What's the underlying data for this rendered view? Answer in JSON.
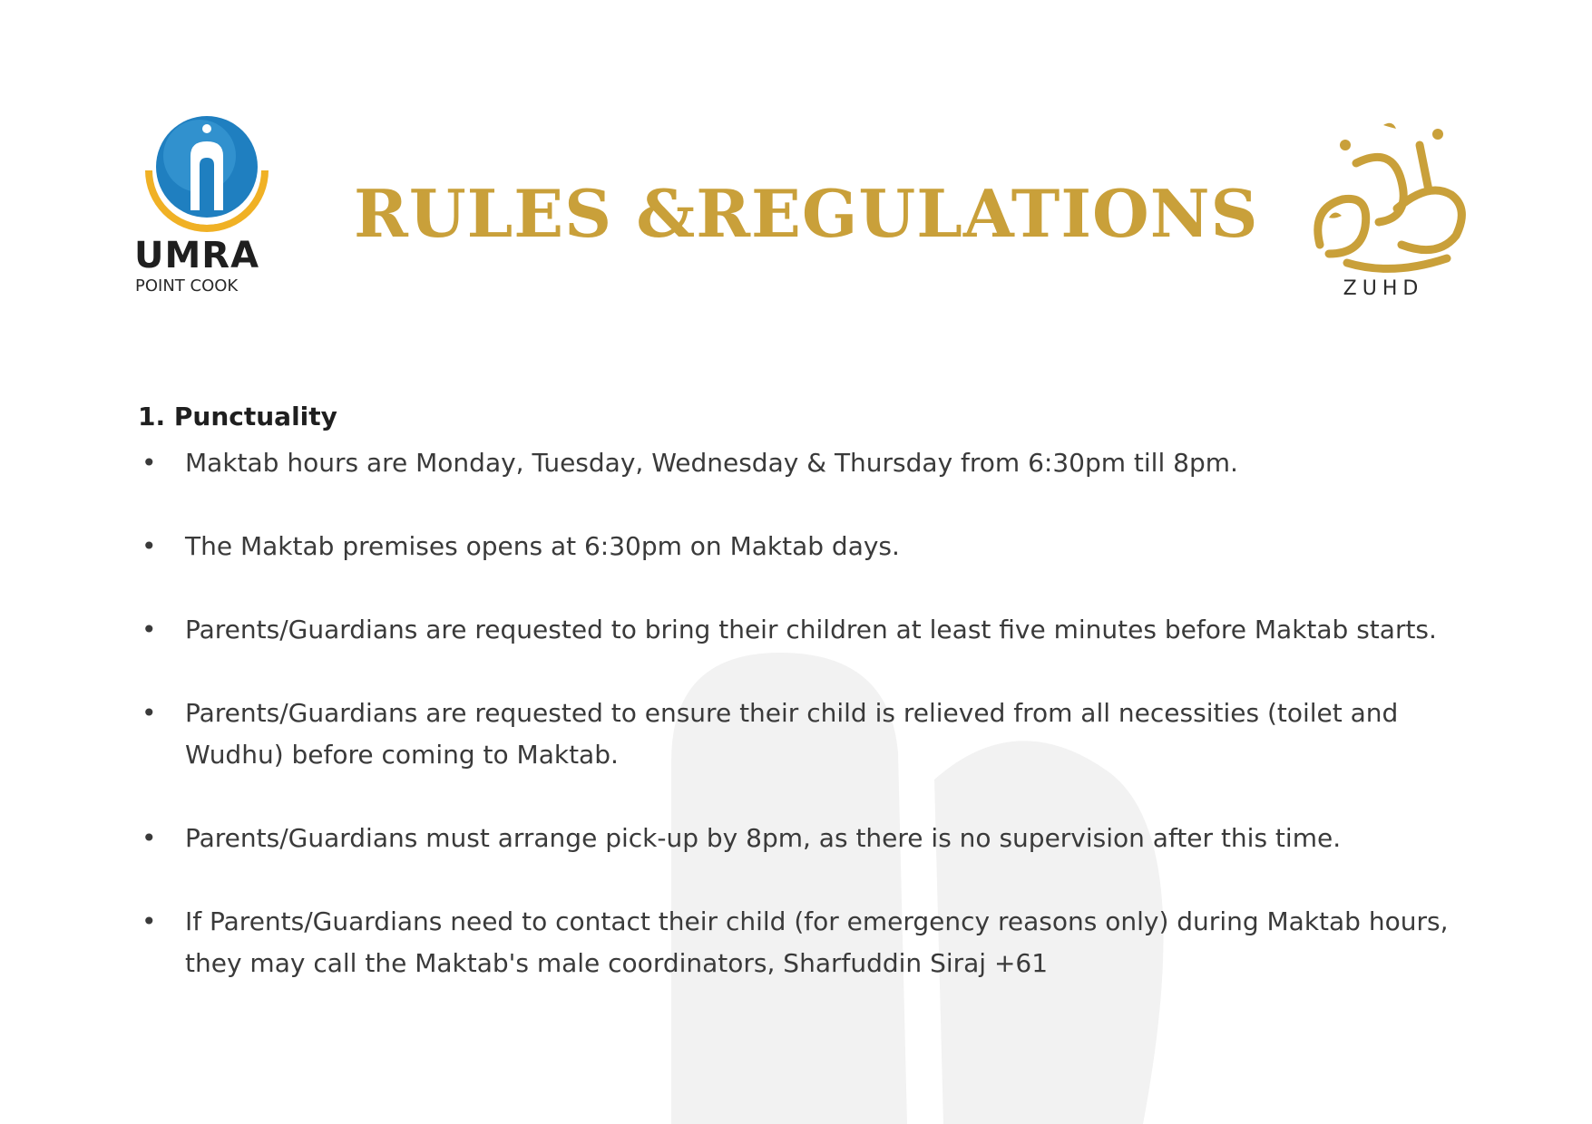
{
  "header": {
    "left_logo": {
      "name": "UMRA",
      "subtitle": "POINT COOK"
    },
    "title": "RULES &REGULATIONS",
    "right_logo": {
      "name": "ZUHD"
    }
  },
  "section": {
    "heading": "1. Punctuality",
    "rules": [
      "Maktab hours are Monday, Tuesday, Wednesday & Thursday from 6:30pm till 8pm.",
      "The Maktab premises opens at 6:30pm on Maktab days.",
      "Parents/Guardians are requested to bring their children at least five minutes before Maktab starts.",
      "Parents/Guardians are requested to ensure their child is relieved from all necessities (toilet and Wudhu) before coming to Maktab.",
      "Parents/Guardians must arrange pick-up by 8pm, as there is no supervision after this time.",
      "If Parents/Guardians need to contact their child (for emergency reasons only) during Maktab hours, they may call the Maktab's male coordinators, Sharfuddin Siraj +61"
    ]
  },
  "colors": {
    "gold": "#c9a03a",
    "text": "#3a3a3a",
    "blue": "#1f7fc0"
  }
}
